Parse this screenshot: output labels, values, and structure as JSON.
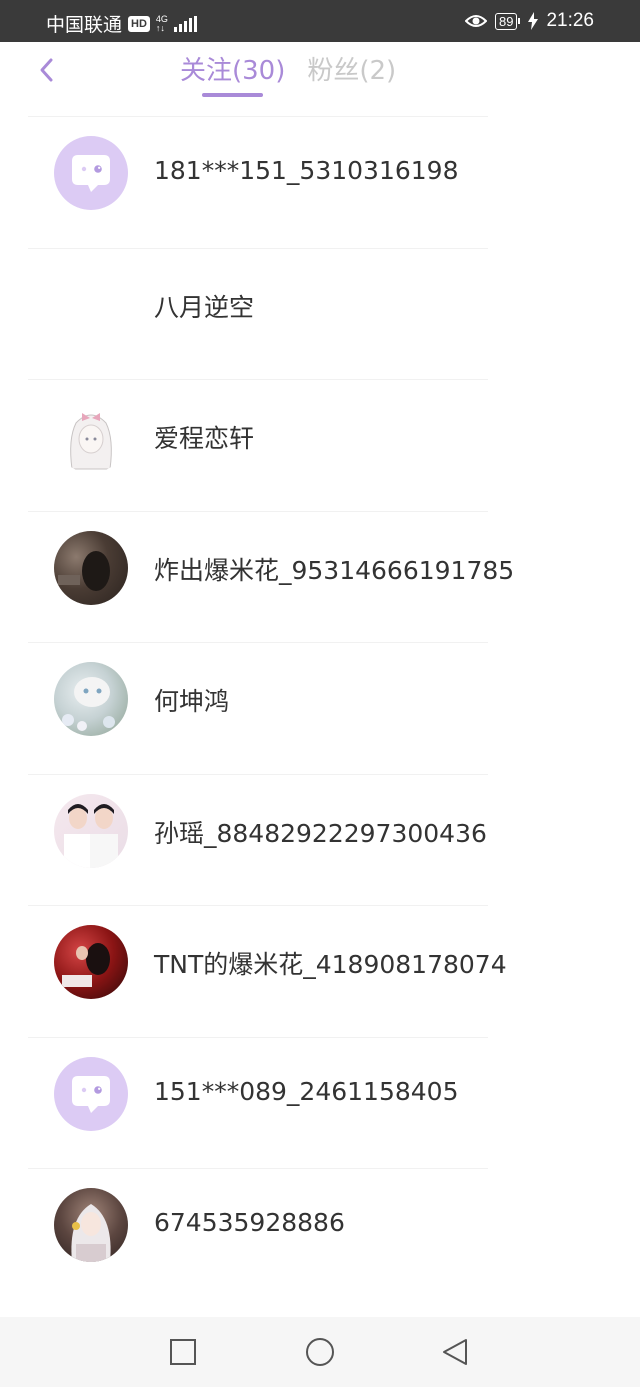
{
  "status_bar": {
    "carrier": "中国联通",
    "hd_badge": "HD",
    "network": "4G",
    "network_sub": "↑↓",
    "battery": "89",
    "time": "21:26"
  },
  "header": {
    "tabs": [
      {
        "label": "关注(30)",
        "active": true
      },
      {
        "label": "粉丝(2)",
        "active": false
      }
    ]
  },
  "follow_list": [
    {
      "name": "181***151_5310316198",
      "avatar": "default-chat"
    },
    {
      "name": "八月逆空",
      "avatar": "none"
    },
    {
      "name": "爱程恋轩",
      "avatar": "anime-girl"
    },
    {
      "name": "炸出爆米花_95314666191785",
      "avatar": "dark-photo"
    },
    {
      "name": "何坤鸿",
      "avatar": "cat-flowers"
    },
    {
      "name": "孙瑶_88482922297300436",
      "avatar": "two-boys"
    },
    {
      "name": "TNT的爆米花_418908178074",
      "avatar": "red-photo"
    },
    {
      "name": "151***089_2461158405",
      "avatar": "default-chat"
    },
    {
      "name": "674535928886",
      "avatar": "white-hair-girl"
    }
  ],
  "colors": {
    "accent": "#a98ad8",
    "avatar_default_bg": "#dccbf4",
    "tab_inactive": "#c9c9c9"
  }
}
